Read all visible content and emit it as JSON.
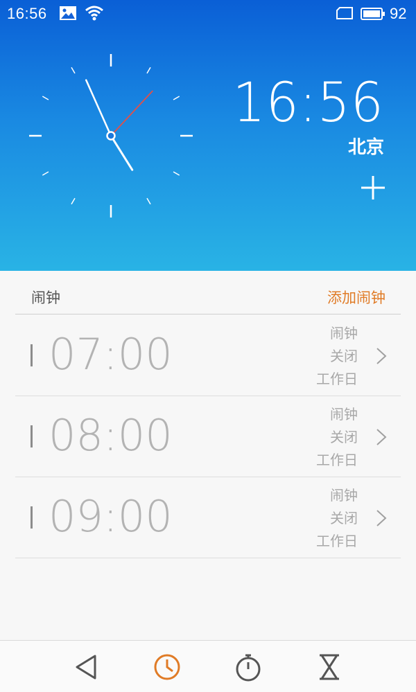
{
  "status_bar": {
    "time": "16:56",
    "battery": "92",
    "icons": [
      "image-icon",
      "wifi-icon",
      "sim-icon",
      "battery-icon"
    ]
  },
  "world_clock": {
    "analog_time": "16:56",
    "digital_time": "16:56",
    "city": "北京"
  },
  "alarms": {
    "section_title": "闹钟",
    "add_label": "添加闹钟",
    "items": [
      {
        "time": "07:00",
        "label": "闹钟",
        "status": "关闭",
        "repeat": "工作日"
      },
      {
        "time": "08:00",
        "label": "闹钟",
        "status": "关闭",
        "repeat": "工作日"
      },
      {
        "time": "09:00",
        "label": "闹钟",
        "status": "关闭",
        "repeat": "工作日"
      }
    ]
  },
  "bottom_nav": {
    "items": [
      "back-icon",
      "clock-icon",
      "stopwatch-icon",
      "timer-icon"
    ],
    "active": "clock-icon"
  },
  "colors": {
    "gradient_top": "#0a5fd6",
    "gradient_bottom": "#29b3e5",
    "accent": "#e07b26",
    "second_hand": "#e0504a"
  }
}
